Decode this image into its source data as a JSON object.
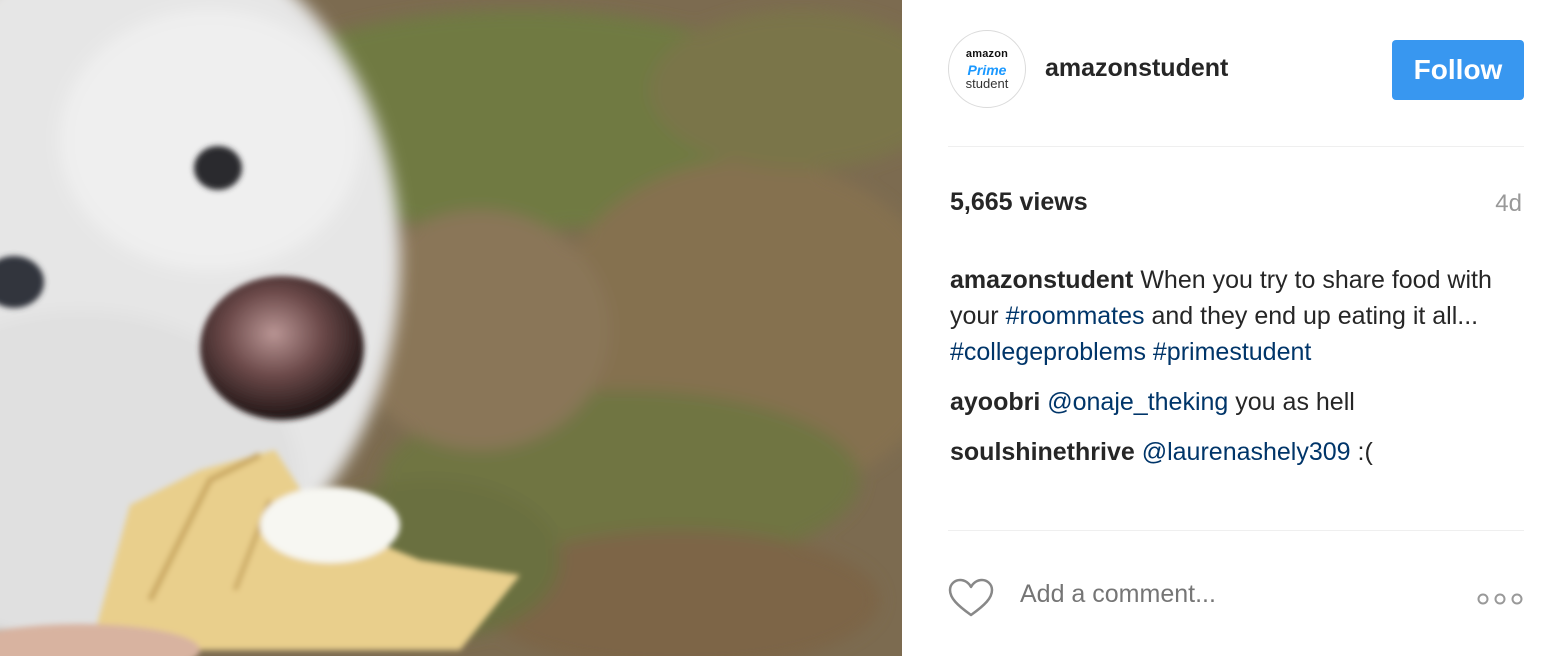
{
  "post": {
    "username": "amazonstudent",
    "avatar": {
      "line1": "amazon",
      "line2": "Prime",
      "line3": "student"
    },
    "follow_label": "Follow",
    "views": "5,665 views",
    "timestamp": "4d"
  },
  "caption": {
    "user": "amazonstudent",
    "text1": "When you try to share food with your",
    "tag1": "#roommates",
    "text2": "and they end up eating it all...",
    "tag2": "#collegeproblems",
    "tag3": "#primestudent"
  },
  "comments": [
    {
      "user": "ayoobri",
      "mention": "@onaje_theking",
      "text": "you as hell"
    },
    {
      "user": "soulshinethrive",
      "mention": "@laurenashely309",
      "text": ":("
    }
  ],
  "add_comment": {
    "placeholder": "Add a comment..."
  },
  "icons": {
    "like": "heart-icon",
    "more": "more-options-icon"
  },
  "colors": {
    "follow_button": "#3897f0",
    "hashtag": "#003569",
    "muted": "#999999"
  }
}
